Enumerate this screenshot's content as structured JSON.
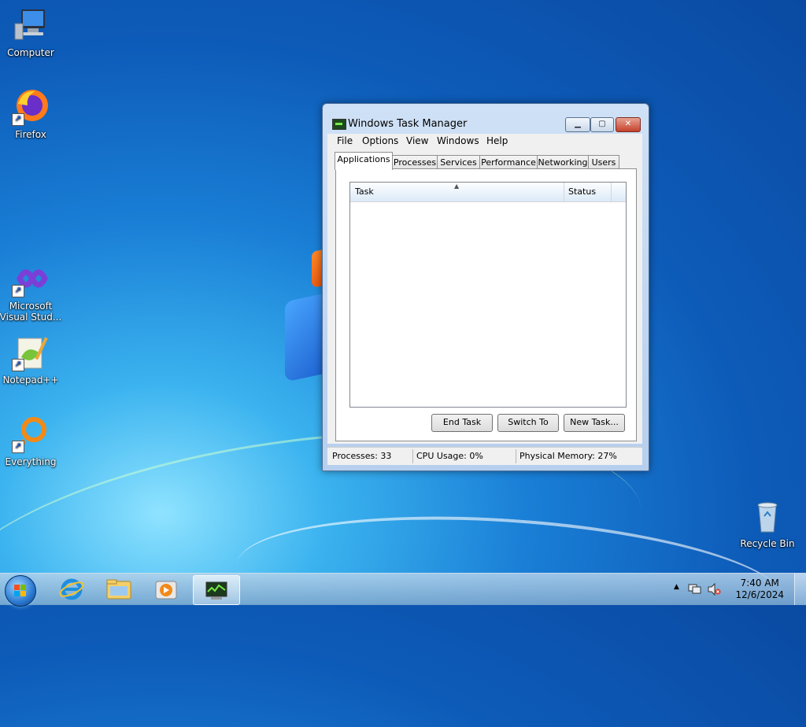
{
  "desktop": {
    "icons": [
      {
        "label": "Computer"
      },
      {
        "label": "Firefox"
      },
      {
        "label": "Microsoft Visual Stud..."
      },
      {
        "label": "Notepad++"
      },
      {
        "label": "Everything"
      },
      {
        "label": "Recycle Bin"
      }
    ]
  },
  "window": {
    "title": "Windows Task Manager",
    "min_glyph": "▁",
    "max_glyph": "▢",
    "close_glyph": "✕",
    "menu": [
      "File",
      "Options",
      "View",
      "Windows",
      "Help"
    ],
    "tabs": [
      "Applications",
      "Processes",
      "Services",
      "Performance",
      "Networking",
      "Users"
    ],
    "active_tab": "Applications",
    "list": {
      "columns": [
        "Task",
        "Status"
      ],
      "rows": [],
      "sort_glyph": "▲"
    },
    "buttons": {
      "end_task": "End Task",
      "switch_to": "Switch To",
      "new_task": "New Task..."
    },
    "status": {
      "processes": "Processes: 33",
      "cpu": "CPU Usage: 0%",
      "memory": "Physical Memory: 27%"
    }
  },
  "taskbar": {
    "pinned": [
      {
        "name": "internet-explorer"
      },
      {
        "name": "windows-explorer"
      },
      {
        "name": "media-player"
      },
      {
        "name": "task-manager",
        "active": true
      }
    ],
    "tray": {
      "expand_glyph": "▲",
      "time": "7:40 AM",
      "date": "12/6/2024"
    }
  }
}
